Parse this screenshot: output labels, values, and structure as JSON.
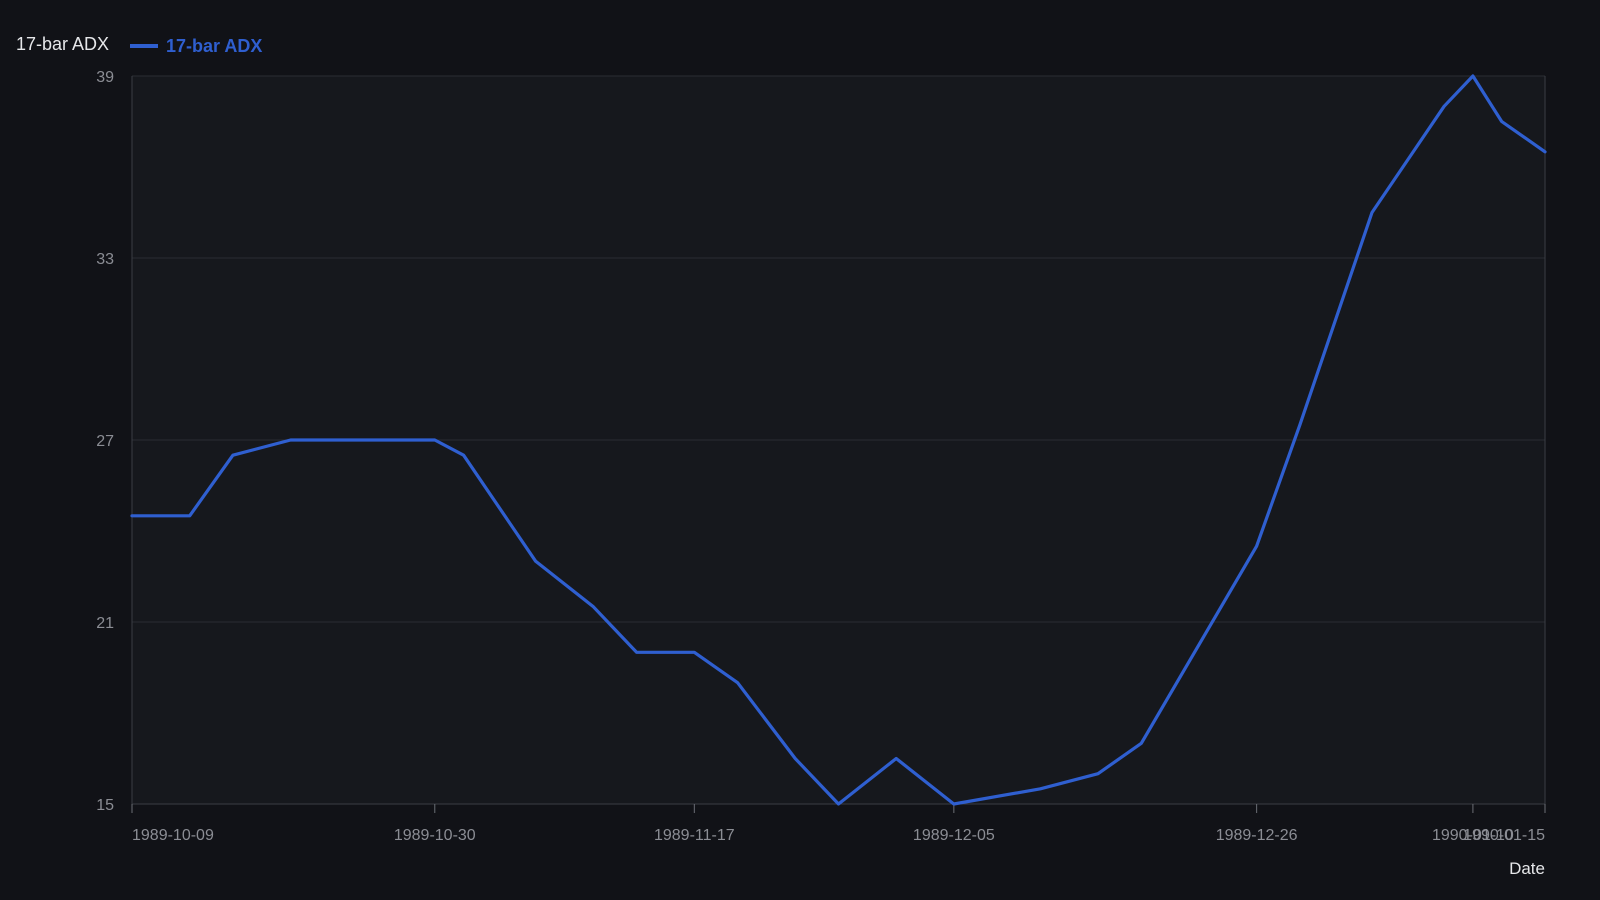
{
  "chart_data": {
    "type": "line",
    "title": "17-bar ADX",
    "xlabel": "Date",
    "ylabel": "",
    "ylim": [
      15,
      39
    ],
    "yticks": [
      15,
      21,
      27,
      33,
      39
    ],
    "xlim": [
      "1989-10-09",
      "1990-01-15"
    ],
    "xticks": [
      "1989-10-09",
      "1989-10-30",
      "1989-11-17",
      "1989-12-05",
      "1989-12-26",
      "1990-01-10",
      "1990-01-15"
    ],
    "grid": true,
    "legend": "top-left",
    "colors": {
      "background": "#111217",
      "plot": "#16181d",
      "line": "#2f5fd0",
      "grid": "#2a2d33",
      "axis": "#3a3d44"
    },
    "series": [
      {
        "name": "17-bar ADX",
        "x": [
          "1989-10-09",
          "1989-10-13",
          "1989-10-16",
          "1989-10-20",
          "1989-10-24",
          "1989-10-30",
          "1989-11-01",
          "1989-11-06",
          "1989-11-10",
          "1989-11-13",
          "1989-11-17",
          "1989-11-20",
          "1989-11-24",
          "1989-11-27",
          "1989-12-01",
          "1989-12-05",
          "1989-12-11",
          "1989-12-15",
          "1989-12-18",
          "1989-12-26",
          "1989-12-29",
          "1990-01-03",
          "1990-01-08",
          "1990-01-10",
          "1990-01-12",
          "1990-01-15"
        ],
        "values": [
          24.5,
          24.5,
          26.5,
          27.0,
          27.0,
          27.0,
          26.5,
          23.0,
          21.5,
          20.0,
          20.0,
          19.0,
          16.5,
          15.0,
          16.5,
          15.0,
          15.5,
          16.0,
          17.0,
          23.5,
          27.5,
          34.5,
          38.0,
          39.0,
          37.5,
          36.5
        ]
      }
    ]
  }
}
